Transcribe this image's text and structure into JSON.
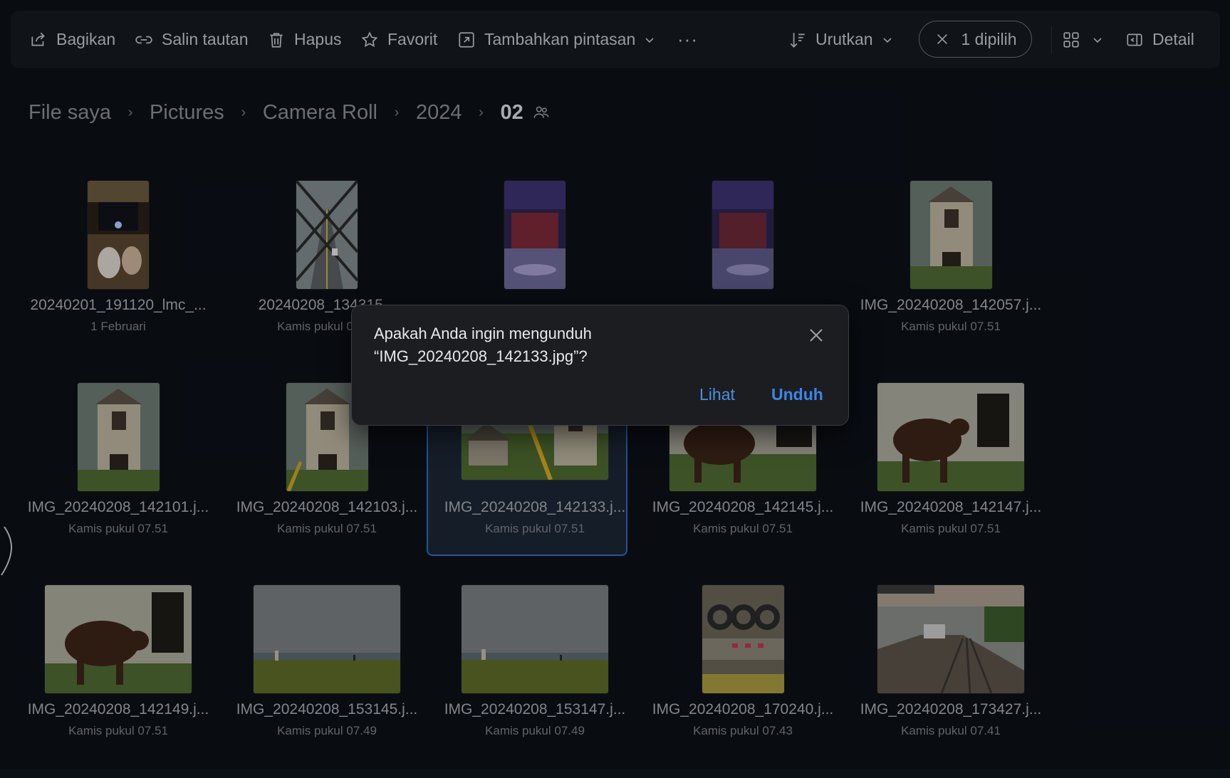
{
  "toolbar": {
    "share": "Bagikan",
    "copy_link": "Salin tautan",
    "delete": "Hapus",
    "favorite": "Favorit",
    "add_shortcut": "Tambahkan pintasan",
    "more": "···",
    "sort": "Urutkan",
    "selected_count": "1 dipilih",
    "details": "Detail"
  },
  "breadcrumb": {
    "items": [
      "File saya",
      "Pictures",
      "Camera Roll",
      "2024"
    ],
    "current": "02",
    "separator": "›"
  },
  "files": [
    {
      "name": "20240201_191120_lmc_...",
      "date": "1 Februari"
    },
    {
      "name": "20240208_134315...",
      "date": "Kamis pukul 07.51"
    },
    {
      "name": "",
      "date": ""
    },
    {
      "name": "",
      "date": ""
    },
    {
      "name": "IMG_20240208_142057.j...",
      "date": "Kamis pukul 07.51"
    },
    {
      "name": "IMG_20240208_142101.j...",
      "date": "Kamis pukul 07.51"
    },
    {
      "name": "IMG_20240208_142103.j...",
      "date": "Kamis pukul 07.51"
    },
    {
      "name": "IMG_20240208_142133.j...",
      "date": "Kamis pukul 07.51"
    },
    {
      "name": "IMG_20240208_142145.j...",
      "date": "Kamis pukul 07.51"
    },
    {
      "name": "IMG_20240208_142147.j...",
      "date": "Kamis pukul 07.51"
    },
    {
      "name": "IMG_20240208_142149.j...",
      "date": "Kamis pukul 07.51"
    },
    {
      "name": "IMG_20240208_153145.j...",
      "date": "Kamis pukul 07.49"
    },
    {
      "name": "IMG_20240208_153147.j...",
      "date": "Kamis pukul 07.49"
    },
    {
      "name": "IMG_20240208_170240.j...",
      "date": "Kamis pukul 07.43"
    },
    {
      "name": "IMG_20240208_173427.j...",
      "date": "Kamis pukul 07.41"
    }
  ],
  "dialog": {
    "message_line1": "Apakah Anda ingin mengunduh",
    "message_line2": "“IMG_20240208_142133.jpg”?",
    "view_button": "Lihat",
    "download_button": "Unduh"
  },
  "colors": {
    "accent": "#3d86e8",
    "selection_border": "#2d6dbf",
    "background": "#0c1017"
  }
}
